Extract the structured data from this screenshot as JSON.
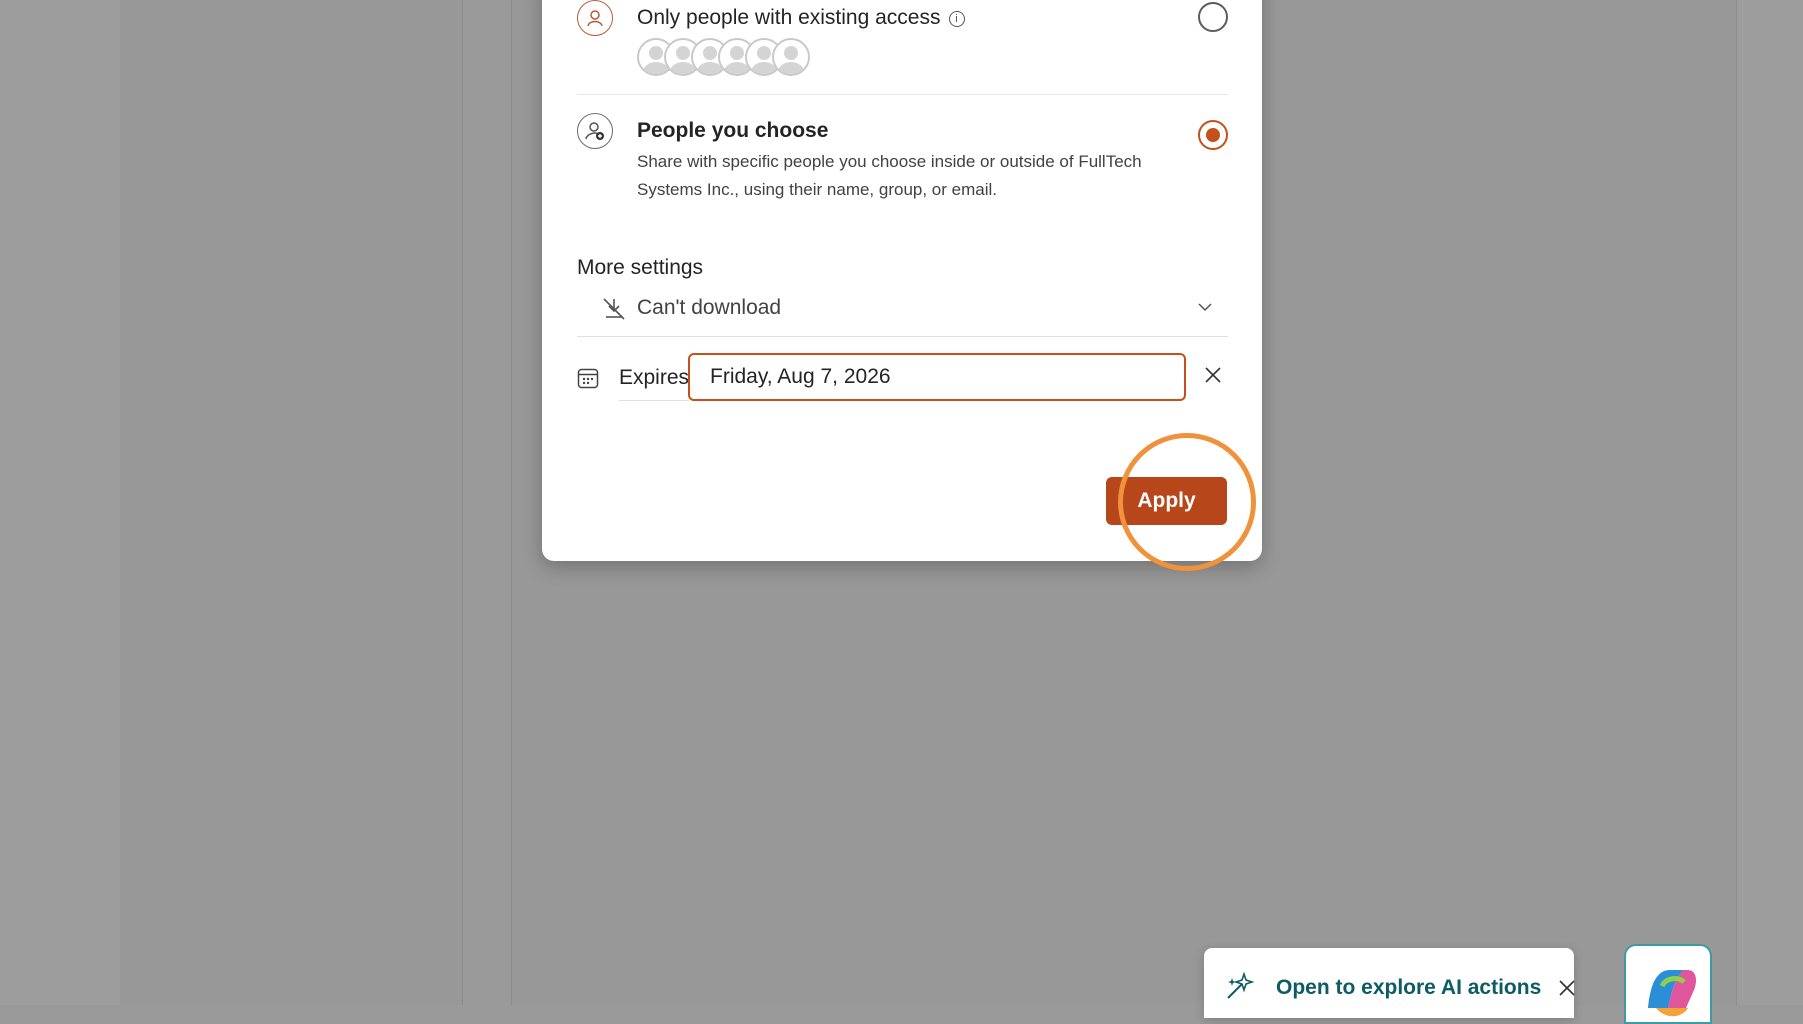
{
  "sharing_options": [
    {
      "title": "Only people with existing access",
      "selected": false,
      "avatar_count": 6
    },
    {
      "title": "People you choose",
      "description": "Share with specific people you choose inside or outside of FullTech Systems Inc., using their name, group, or email.",
      "selected": true
    }
  ],
  "more_settings": {
    "title": "More settings",
    "download_option": "Can't download",
    "expires_label": "Expires",
    "expires_value": "Friday, Aug 7, 2026"
  },
  "apply_label": "Apply",
  "ai_toast": {
    "text": "Open to explore AI actions"
  },
  "colors": {
    "accent": "#b7461a",
    "ring": "#f0923b",
    "toast_text": "#0e5c63"
  }
}
